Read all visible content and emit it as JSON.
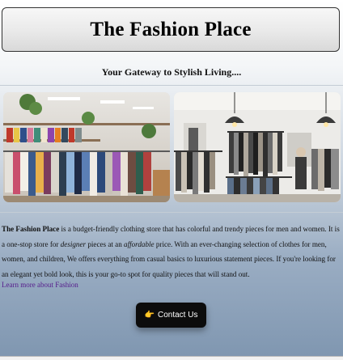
{
  "header": {
    "title": "The Fashion Place"
  },
  "tagline": "Your Gateway to Stylish Living....",
  "images": [
    {
      "name": "store-interior-photo-left",
      "icon": "clothing-store-photo"
    },
    {
      "name": "store-interior-photo-right",
      "icon": "clothing-store-photo"
    }
  ],
  "about": {
    "brand": "The Fashion Place",
    "text1": " is a budget-friendly clothing store that has colorful and trendy pieces for men and women. It is a one-stop store for ",
    "designer": "designer",
    "text2": " pieces at an ",
    "affordable": "affordable",
    "text3": " price. With an ever-changing selection of clothes for men, women, and children, We offers everything from casual basics to luxurious statement pieces. If you're looking for an elegant yet bold look, this is your go-to spot for quality pieces that will stand out."
  },
  "links": {
    "learn_more": "Learn more about Fashion"
  },
  "contact_button": {
    "icon": "👉",
    "label": "Contact Us"
  },
  "colors": {
    "background_top": "#ffffff",
    "background_bottom": "#7f96b0",
    "button_bg": "#0c0c0c",
    "link": "#551a8b"
  }
}
